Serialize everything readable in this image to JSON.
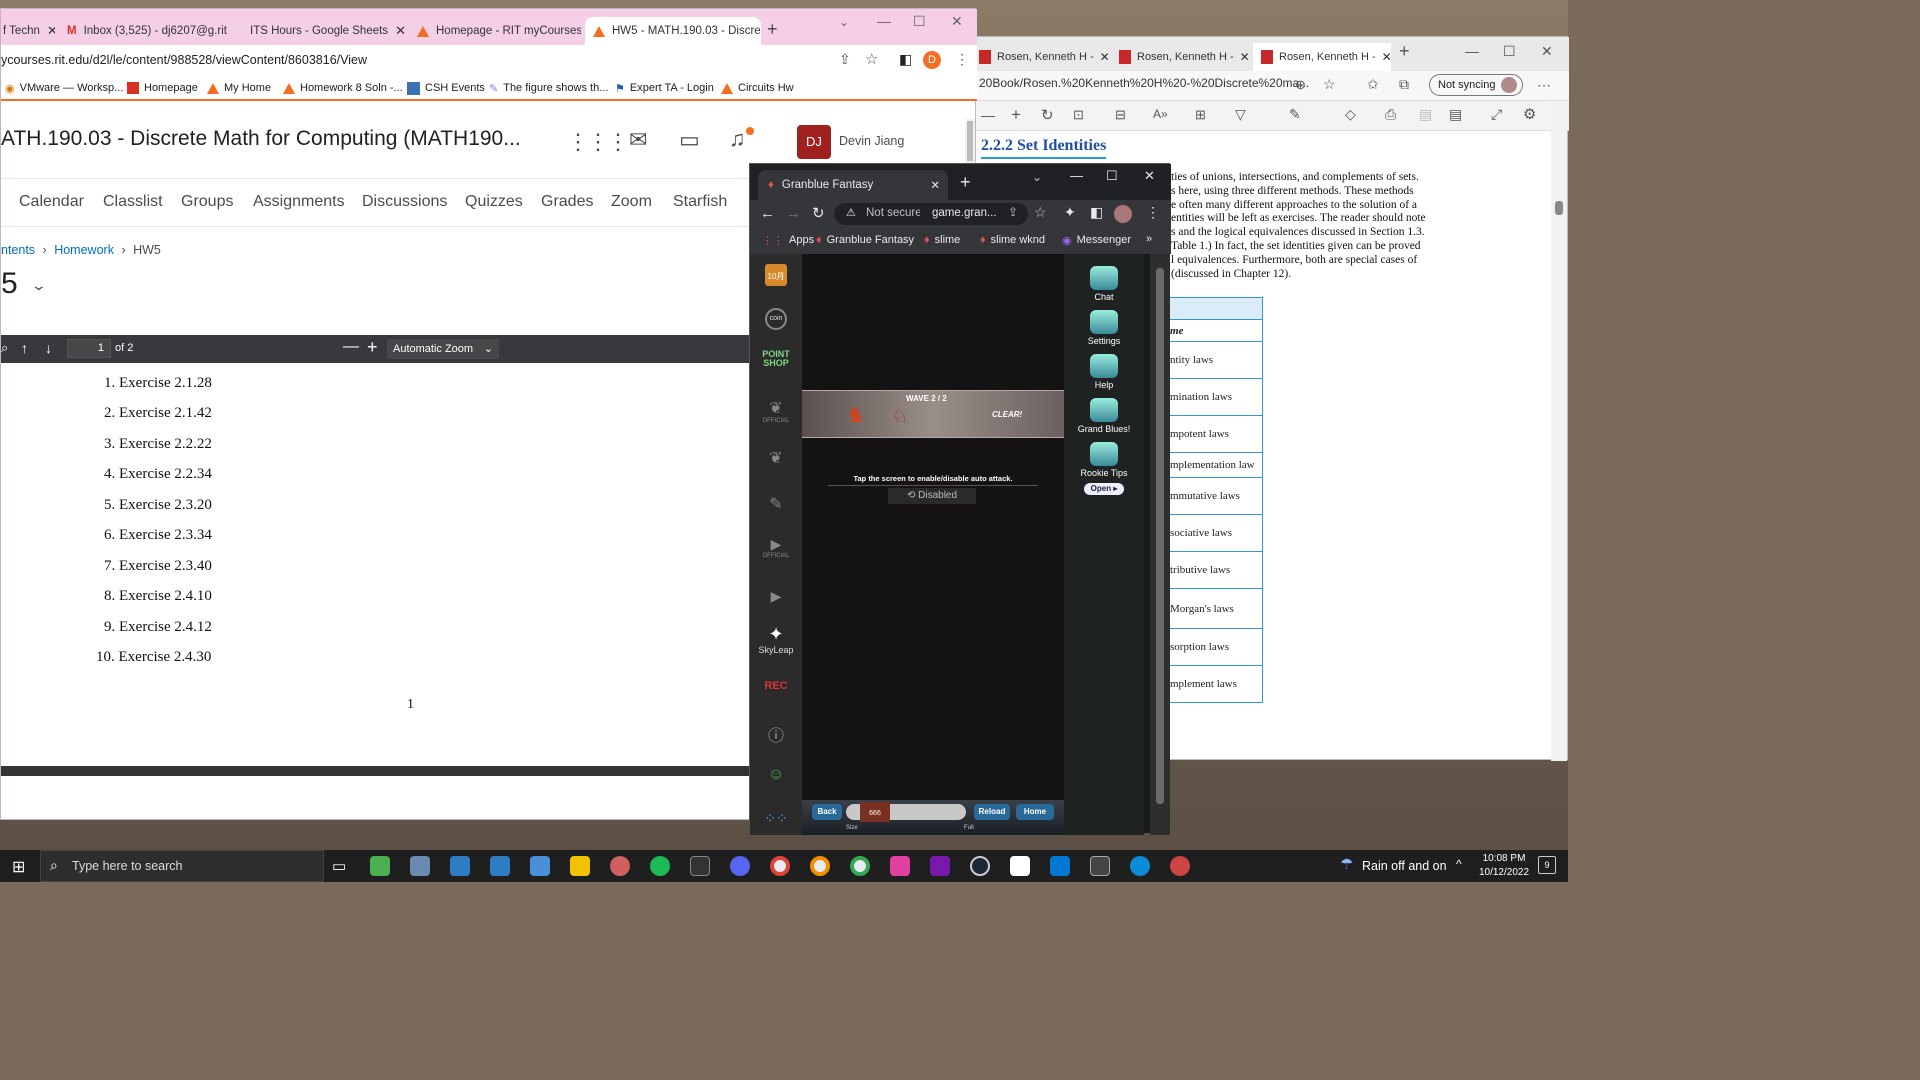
{
  "edge": {
    "tabs": [
      "Rosen, Kenneth H -",
      "Rosen, Kenneth H -",
      "Rosen, Kenneth H -"
    ],
    "address": "20Book/Rosen.%20Kenneth%20H%20-%20Discrete%20ma...",
    "sync": "Not syncing",
    "section": "2.2.2   Set Identities",
    "paragraph": [
      "ties of unions, intersections, and complements of sets.",
      "s here, using three different methods. These methods",
      "e often many different approaches to the solution of a",
      "entities will be left as exercises. The reader should note",
      "s and the logical equivalences discussed in Section 1.3.",
      "Table 1.) In fact, the set identities given can be proved",
      "l equivalences. Furthermore, both are special cases of",
      " (discussed in Chapter 12)."
    ],
    "table": [
      "me",
      "ntity laws",
      "mination laws",
      "mpotent laws",
      "mplementation law",
      "mmutative laws",
      "sociative laws",
      "tributive laws",
      " Morgan's laws",
      "sorption laws",
      "mplement laws"
    ]
  },
  "chrome": {
    "tabs": [
      "f Techn",
      "Inbox (3,525) - dj6207@g.rit",
      "ITS Hours - Google Sheets",
      "Homepage - RIT myCourses",
      "HW5 - MATH.190.03 - Discre"
    ],
    "url": "ycourses.rit.edu/d2l/le/content/988528/viewContent/8603816/View",
    "profile_initial": "D",
    "bookmarks": [
      "VMware — Worksp...",
      "Homepage",
      "My Home",
      "Homework 8 Soln -...",
      "CSH Events",
      "The figure shows th...",
      "Expert TA - Login",
      "Circuits Hw"
    ],
    "course_title": "ATH.190.03 - Discrete Math for Computing (MATH190...",
    "user_initials": "DJ",
    "user_name": "Devin Jiang",
    "nav": [
      "Calendar",
      "Classlist",
      "Groups",
      "Assignments",
      "Discussions",
      "Quizzes",
      "Grades",
      "Zoom",
      "Starfish"
    ],
    "breadcrumb": [
      "ntents",
      "Homework",
      "HW5"
    ],
    "page_heading": "5",
    "pdf": {
      "page": "1",
      "of": "of 2",
      "zoom": "Automatic Zoom",
      "page_footer": "1"
    },
    "exercises": [
      "1.  Exercise 2.1.28",
      "2.  Exercise 2.1.42",
      "3.  Exercise 2.2.22",
      "4.  Exercise 2.2.34",
      "5.  Exercise 2.3.20",
      "6.  Exercise 2.3.34",
      "7.  Exercise 2.3.40",
      "8.  Exercise 2.4.10",
      "9.  Exercise 2.4.12",
      "10.  Exercise 2.4.30"
    ]
  },
  "gb": {
    "tab": "Granblue Fantasy",
    "not_secure": "Not secure",
    "url": "game.gran...",
    "bookmarks": [
      "Apps",
      "Granblue Fantasy",
      "slime",
      "slime wknd",
      "Messenger"
    ],
    "side": [
      "10月",
      "coin",
      "POINT SHOP",
      "OFFICIAL",
      "",
      "",
      "OFFICIAL",
      "",
      "SkyLeap",
      "REC",
      "",
      "",
      ""
    ],
    "right": [
      "Chat",
      "Settings",
      "Help",
      "Grand Blues!",
      "Rookie Tips",
      "Open ▸"
    ],
    "wave": "WAVE   2 / 2",
    "clear": "CLEAR!",
    "tap": "Tap the screen to enable/disable auto attack.",
    "auto": "Disabled",
    "bottom": [
      "Back",
      "Reload",
      "Home"
    ],
    "gauge": "666",
    "small": [
      "Size",
      "Full"
    ]
  },
  "taskbar": {
    "search": "Type here to search",
    "weather": "Rain off and on",
    "time": "10:08 PM",
    "date": "10/12/2022",
    "notif": "9"
  }
}
